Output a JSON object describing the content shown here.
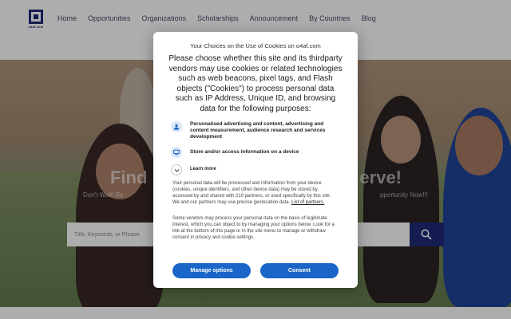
{
  "header": {
    "logo_text": "o4af.com",
    "nav": [
      "Home",
      "Opportunities",
      "Organizations",
      "Scholarships",
      "Announcement",
      "By Countries",
      "Blog"
    ]
  },
  "hero": {
    "title_left": "Find",
    "title_right": "erve!",
    "subtitle_left": "Don't Wait! Be",
    "subtitle_right": "pportunity Now!!!",
    "search_placeholder": "Title, Keywords, or Phrase"
  },
  "consent": {
    "title": "Your Choices on the Use of Cookies on o4af.com",
    "lead": "Please choose whether this site and its thirdparty vendors may use cookies or related technologies such as web beacons, pixel tags, and Flash objects (\"Cookies\") to process personal data such as IP Address, Unique ID, and browsing data for the following purposes:",
    "purposes": [
      {
        "label": "Personalised advertising and content, advertising and content measurement, audience research and services development",
        "icon": "person-icon"
      },
      {
        "label": "Store and/or access information on a device",
        "icon": "device-icon"
      }
    ],
    "learn_more": "Learn more",
    "para1": "Your personal data will be processed and information from your device (cookies, unique identifiers, and other device data) may be stored by, accessed by and shared with 210 partners, or used specifically by this site. We and our partners may use precise geolocation data.",
    "partners_link": "List of partners.",
    "para2": "Some vendors may process your personal data on the basis of legitimate interest, which you can object to by managing your options below. Look for a link at the bottom of this page or in the site menu to manage or withdraw consent in privacy and cookie settings.",
    "manage_label": "Manage options",
    "consent_label": "Consent"
  },
  "colors": {
    "brand": "#1e2a78",
    "button": "#1a66c8",
    "icon_bg": "#dce6f7"
  }
}
